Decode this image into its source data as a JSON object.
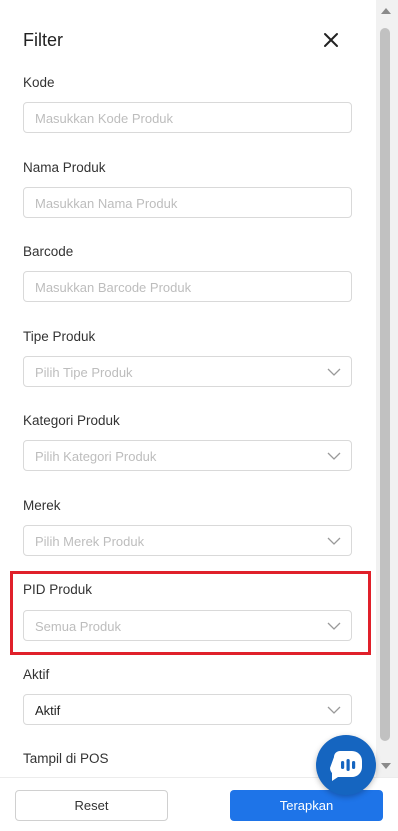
{
  "header": {
    "title": "Filter"
  },
  "fields": {
    "kode": {
      "label": "Kode",
      "placeholder": "Masukkan Kode Produk"
    },
    "nama": {
      "label": "Nama Produk",
      "placeholder": "Masukkan Nama Produk"
    },
    "barcode": {
      "label": "Barcode",
      "placeholder": "Masukkan Barcode Produk"
    },
    "tipe": {
      "label": "Tipe Produk",
      "placeholder": "Pilih Tipe Produk"
    },
    "kategori": {
      "label": "Kategori Produk",
      "placeholder": "Pilih Kategori Produk"
    },
    "merek": {
      "label": "Merek",
      "placeholder": "Pilih Merek Produk"
    },
    "pid": {
      "label": "PID Produk",
      "placeholder": "Semua Produk"
    },
    "aktif": {
      "label": "Aktif",
      "value": "Aktif"
    },
    "pos": {
      "label": "Tampil di POS"
    }
  },
  "footer": {
    "reset_label": "Reset",
    "apply_label": "Terapkan"
  },
  "colors": {
    "accent": "#1e74e8",
    "highlight": "#e0202a",
    "chat": "#1565c0"
  }
}
